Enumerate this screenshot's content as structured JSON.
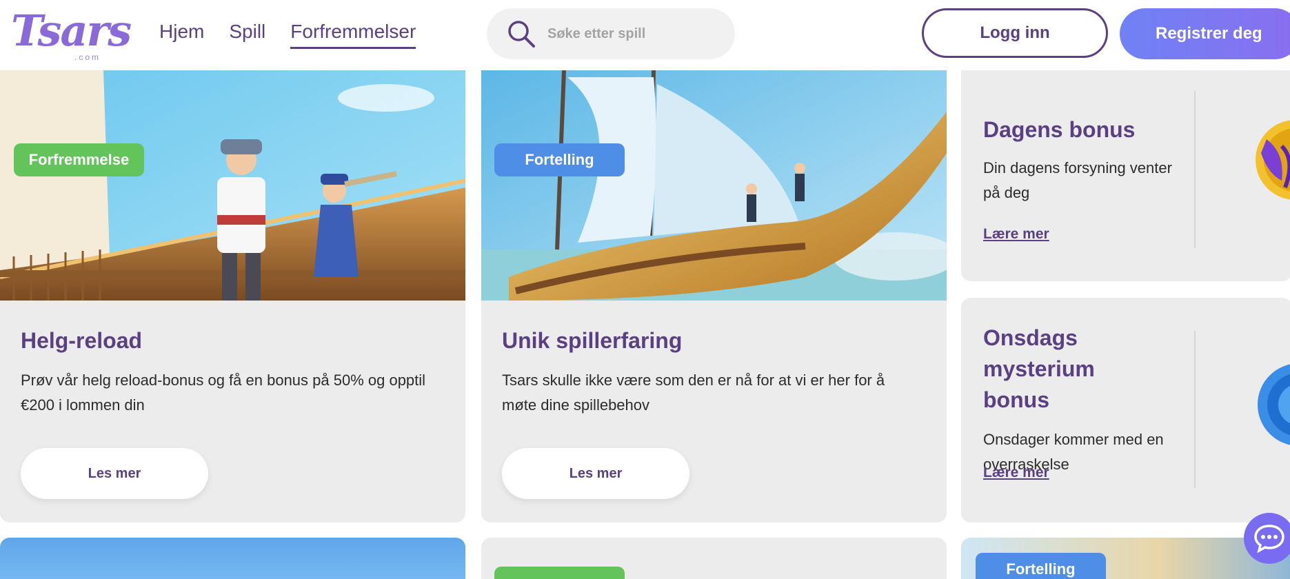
{
  "header": {
    "logo_text": "Tsars",
    "logo_sub": ".com",
    "nav": [
      {
        "label": "Hjem"
      },
      {
        "label": "Spill"
      },
      {
        "label": "Forfremmelser"
      }
    ],
    "search_placeholder": "Søke etter spill",
    "login_label": "Logg inn",
    "register_label": "Registrer deg"
  },
  "cards": [
    {
      "badge": "Forfremmelse",
      "title": "Helg-reload",
      "text": "Prøv vår helg reload-bonus og få en bonus på 50% og opptil €200 i lommen din",
      "button": "Les mer"
    },
    {
      "badge": "Fortelling",
      "title": "Unik spillerfaring",
      "text": "Tsars skulle ikke være som den er nå for at vi er her for å møte dine spillebehov",
      "button": "Les mer"
    }
  ],
  "side_cards": [
    {
      "title": "Dagens bonus",
      "text": "Din dagens forsyning venter på deg",
      "link": "Lære mer"
    },
    {
      "title": "Onsdags mysterium bonus",
      "text": "Onsdager kommer med en overraskelse",
      "link": "Lære mer"
    }
  ],
  "bottom_row": {
    "right_badge": "Fortelling"
  },
  "colors": {
    "brand_purple": "#5a3f82",
    "badge_green": "#62c45a",
    "badge_blue": "#4e8ee6",
    "register_gradient_start": "#6f82f5",
    "register_gradient_end": "#8a6ef0",
    "card_bg": "#ececec"
  },
  "icons": [
    "search-icon",
    "chat-icon"
  ]
}
